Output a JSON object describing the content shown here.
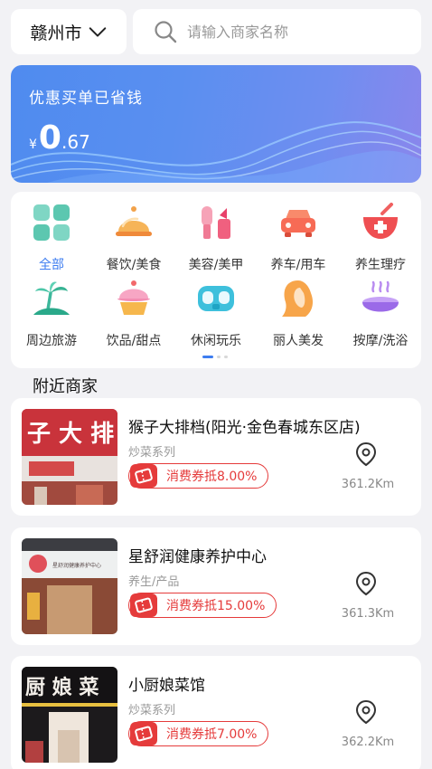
{
  "header": {
    "city": "赣州市",
    "search_placeholder": "请输入商家名称"
  },
  "banner": {
    "title": "优惠买单已省钱",
    "currency": "¥",
    "amount_int": "0",
    "amount_dec": ".67"
  },
  "categories": [
    {
      "label": "全部",
      "icon": "grid-icon",
      "active": true
    },
    {
      "label": "餐饮/美食",
      "icon": "food-cloche-icon"
    },
    {
      "label": "美容/美甲",
      "icon": "lipstick-icon"
    },
    {
      "label": "养车/用车",
      "icon": "car-icon"
    },
    {
      "label": "养生理疗",
      "icon": "medicine-bowl-icon"
    },
    {
      "label": "周边旅游",
      "icon": "palm-island-icon"
    },
    {
      "label": "饮品/甜点",
      "icon": "cupcake-icon"
    },
    {
      "label": "休闲玩乐",
      "icon": "vr-glasses-icon"
    },
    {
      "label": "丽人美发",
      "icon": "hair-beauty-icon"
    },
    {
      "label": "按摩/洗浴",
      "icon": "bath-icon"
    }
  ],
  "pager": {
    "pages": 2,
    "current": 1
  },
  "nearby": {
    "title": "附近商家",
    "shops": [
      {
        "name": "猴子大排档(阳光·金色春城东区店)",
        "category": "炒菜系列",
        "coupon": "消费券抵8.00%",
        "distance": "361.2Km",
        "sign_text": "子 大 排"
      },
      {
        "name": "星舒润健康养护中心",
        "category": "养生/产品",
        "coupon": "消费券抵15.00%",
        "distance": "361.3Km",
        "sign_text": "星舒润健康养护中心"
      },
      {
        "name": "小厨娘菜馆",
        "category": "炒菜系列",
        "coupon": "消费券抵7.00%",
        "distance": "362.2Km",
        "sign_text": "厨 娘 菜"
      }
    ]
  },
  "colors": {
    "accent": "#3e7df0",
    "coupon": "#e53b3b",
    "banner": "#5a8ff0"
  }
}
